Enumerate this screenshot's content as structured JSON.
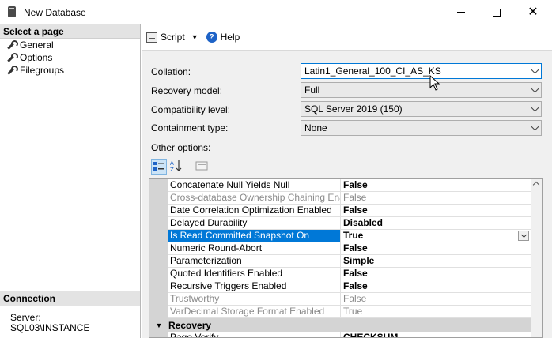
{
  "window": {
    "title": "New Database"
  },
  "sidebar": {
    "header": "Select a page",
    "items": [
      {
        "label": "General",
        "icon": "wrench-icon"
      },
      {
        "label": "Options",
        "icon": "wrench-icon"
      },
      {
        "label": "Filegroups",
        "icon": "wrench-icon"
      }
    ],
    "connection": {
      "header": "Connection",
      "server_label": "Server:",
      "server_value": "SQL03\\INSTANCE"
    }
  },
  "toolbar": {
    "script_label": "Script",
    "help_label": "Help"
  },
  "form": {
    "collation": {
      "label": "Collation:",
      "value": "Latin1_General_100_CI_AS_KS"
    },
    "recovery_model": {
      "label": "Recovery model:",
      "value": "Full"
    },
    "compatibility_level": {
      "label": "Compatibility level:",
      "value": "SQL Server 2019 (150)"
    },
    "containment_type": {
      "label": "Containment type:",
      "value": "None"
    },
    "other_options_label": "Other options:"
  },
  "property_grid": {
    "rows": [
      {
        "name": "Concatenate Null Yields Null",
        "value": "False",
        "readonly": false
      },
      {
        "name": "Cross-database Ownership Chaining Enabled",
        "value": "False",
        "readonly": true
      },
      {
        "name": "Date Correlation Optimization Enabled",
        "value": "False",
        "readonly": false
      },
      {
        "name": "Delayed Durability",
        "value": "Disabled",
        "readonly": false
      },
      {
        "name": "Is Read Committed Snapshot On",
        "value": "True",
        "readonly": false,
        "selected": true
      },
      {
        "name": "Numeric Round-Abort",
        "value": "False",
        "readonly": false
      },
      {
        "name": "Parameterization",
        "value": "Simple",
        "readonly": false
      },
      {
        "name": "Quoted Identifiers Enabled",
        "value": "False",
        "readonly": false
      },
      {
        "name": "Recursive Triggers Enabled",
        "value": "False",
        "readonly": false
      },
      {
        "name": "Trustworthy",
        "value": "False",
        "readonly": true
      },
      {
        "name": "VarDecimal Storage Format Enabled",
        "value": "True",
        "readonly": true
      }
    ],
    "category": "Recovery",
    "after_category": [
      {
        "name": "Page Verify",
        "value": "CHECKSUM",
        "readonly": false
      }
    ]
  },
  "colors": {
    "selection": "#0078d7",
    "panel": "#f0f0f0"
  }
}
